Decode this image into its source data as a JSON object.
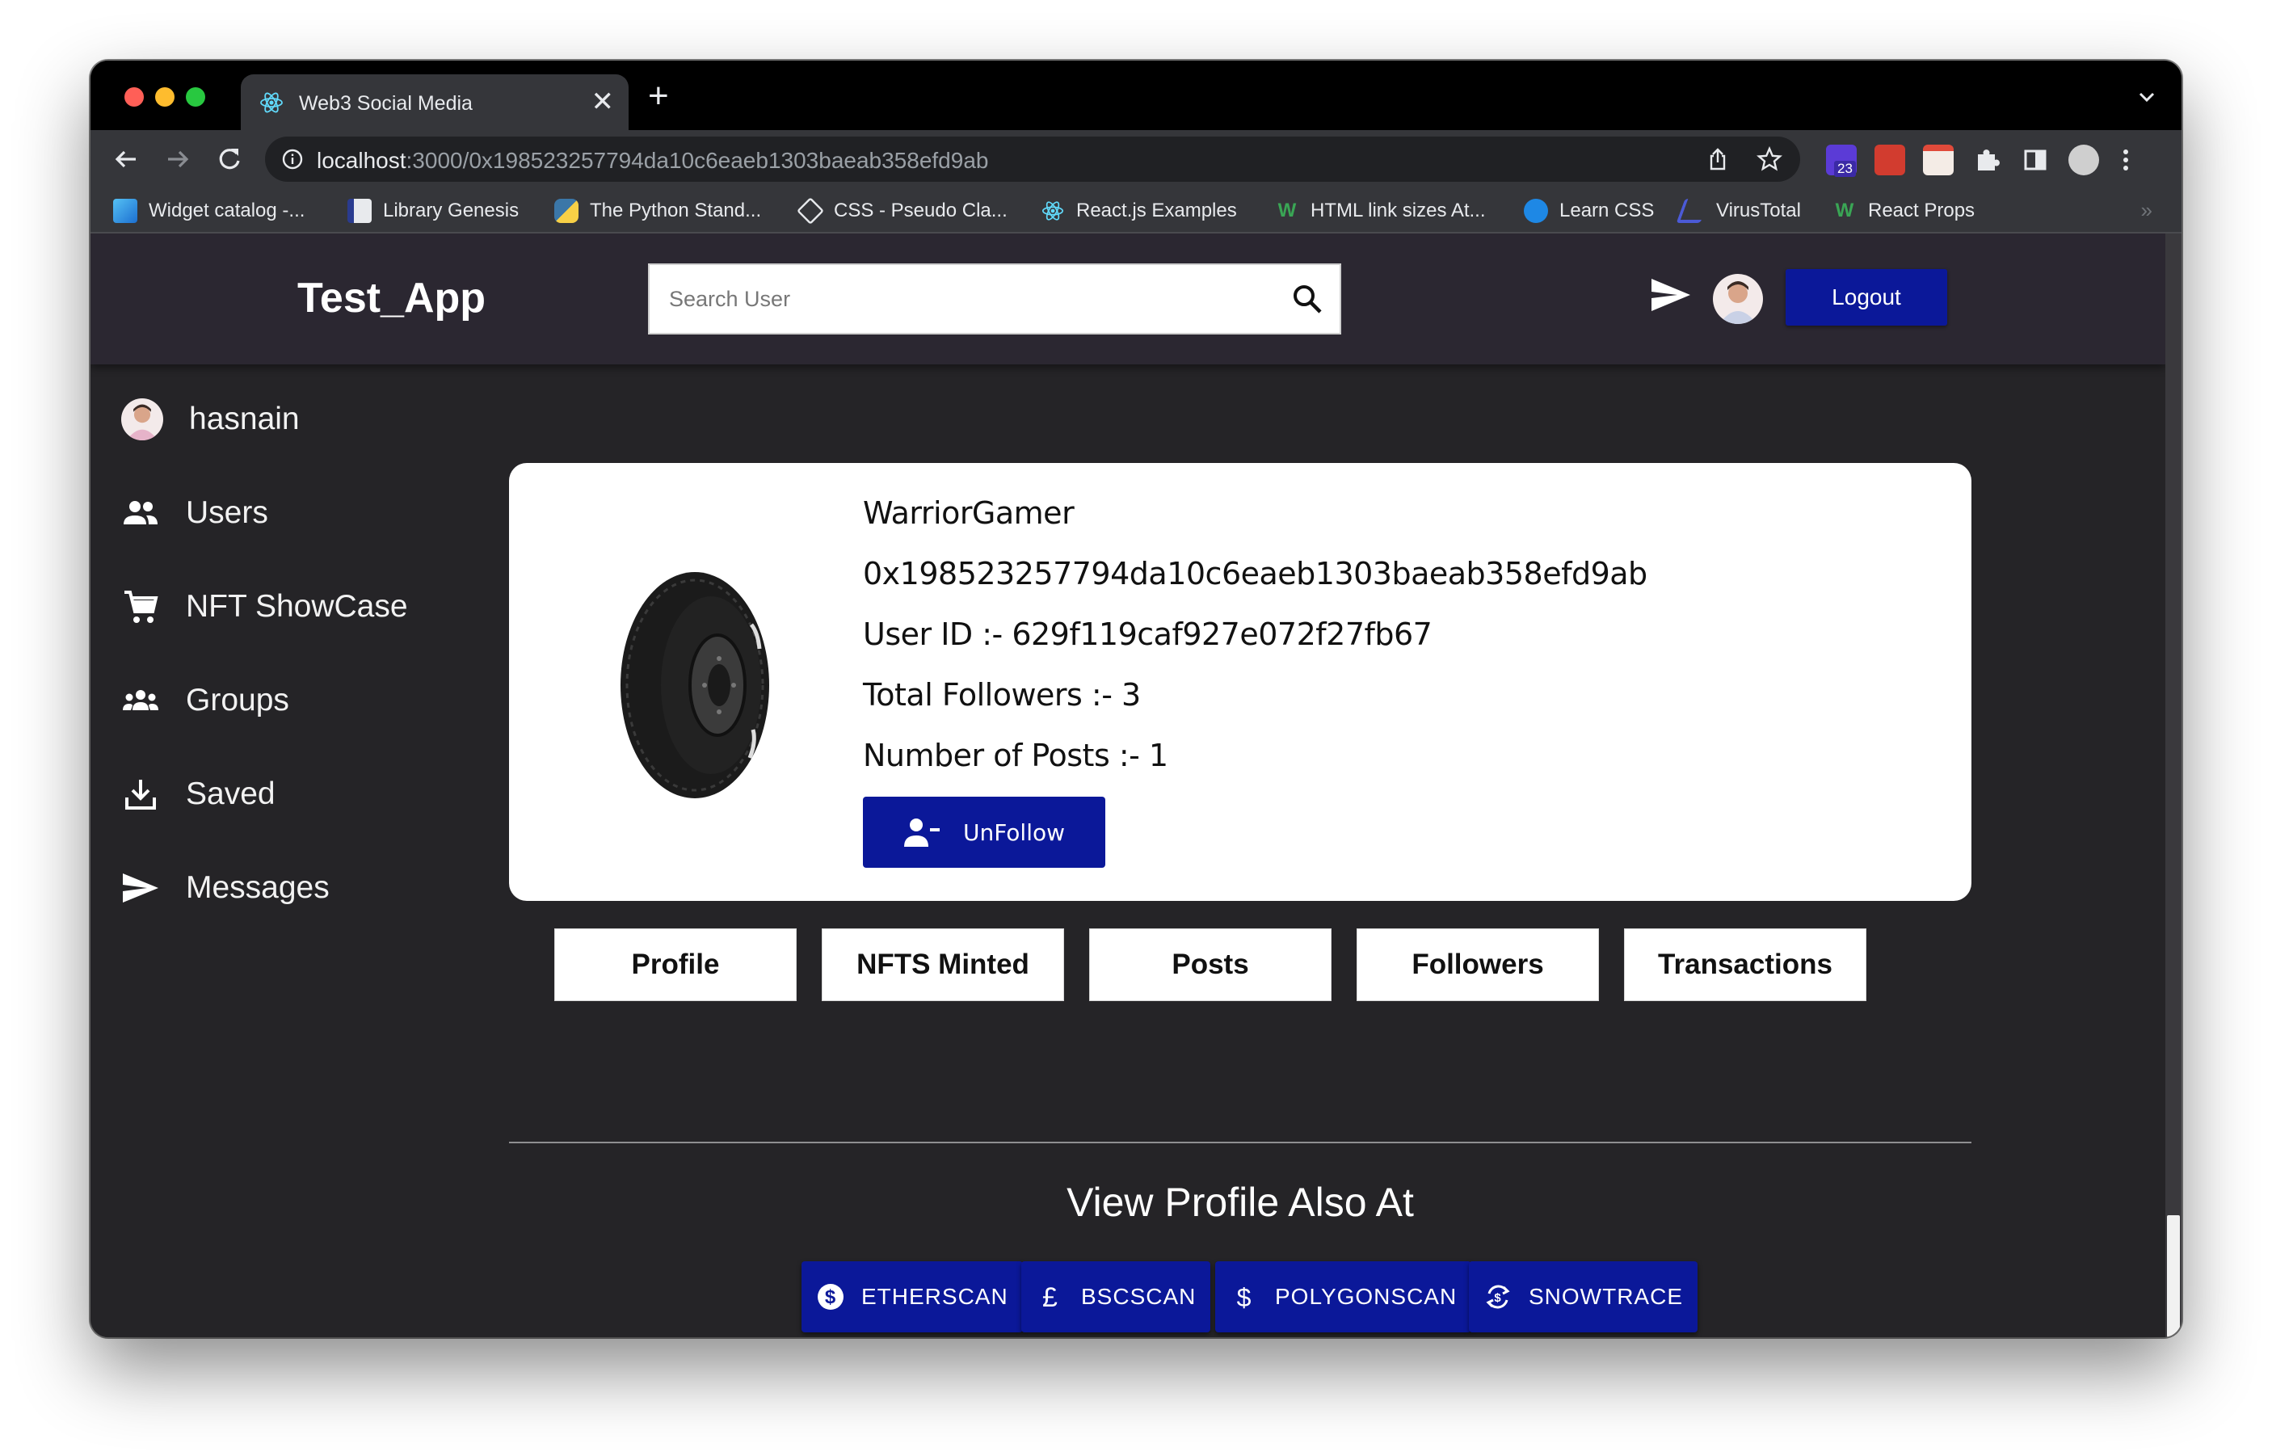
{
  "browser": {
    "tab_title": "Web3 Social Media",
    "new_tab": "+",
    "tab_close": "✕",
    "url_host": "localhost",
    "url_path": ":3000/0x198523257794da10c6eaeb1303baeab358efd9ab",
    "extension_badge": "23",
    "bookmarks": [
      "Widget catalog -...",
      "Library Genesis",
      "The Python Stand...",
      "CSS - Pseudo Cla...",
      "React.js Examples",
      "HTML link sizes At...",
      "Learn CSS",
      "VirusTotal",
      "React Props"
    ],
    "bookmarks_overflow": "»"
  },
  "header": {
    "brand": "Test_App",
    "search_placeholder": "Search User",
    "logout_label": "Logout"
  },
  "sidebar": {
    "user_name": "hasnain",
    "items": [
      {
        "label": "Users",
        "icon": "users-icon"
      },
      {
        "label": "NFT ShowCase",
        "icon": "cart-icon"
      },
      {
        "label": "Groups",
        "icon": "groups-icon"
      },
      {
        "label": "Saved",
        "icon": "download-icon"
      },
      {
        "label": "Messages",
        "icon": "send-icon"
      }
    ]
  },
  "profile": {
    "username": "WarriorGamer",
    "address": "0x198523257794da10c6eaeb1303baeab358efd9ab",
    "user_id": "User ID :- 629f119caf927e072f27fb67",
    "followers": "Total Followers :- 3",
    "posts": "Number of Posts :- 1",
    "unfollow_label": "UnFollow"
  },
  "tabs": [
    "Profile",
    "NFTS Minted",
    "Posts",
    "Followers",
    "Transactions"
  ],
  "explorers": {
    "title": "View Profile Also At",
    "buttons": [
      {
        "label": "ETHERSCAN",
        "icon": "dollar-circle-icon"
      },
      {
        "label": "BSCSCAN",
        "icon": "pound-icon"
      },
      {
        "label": "POLYGONSCAN",
        "icon": "dollar-icon"
      },
      {
        "label": "SNOWTRACE",
        "icon": "currency-exchange-icon"
      }
    ]
  },
  "colors": {
    "accent": "#0b1899",
    "page_bg": "#252427",
    "header_bg": "#2b2731"
  }
}
